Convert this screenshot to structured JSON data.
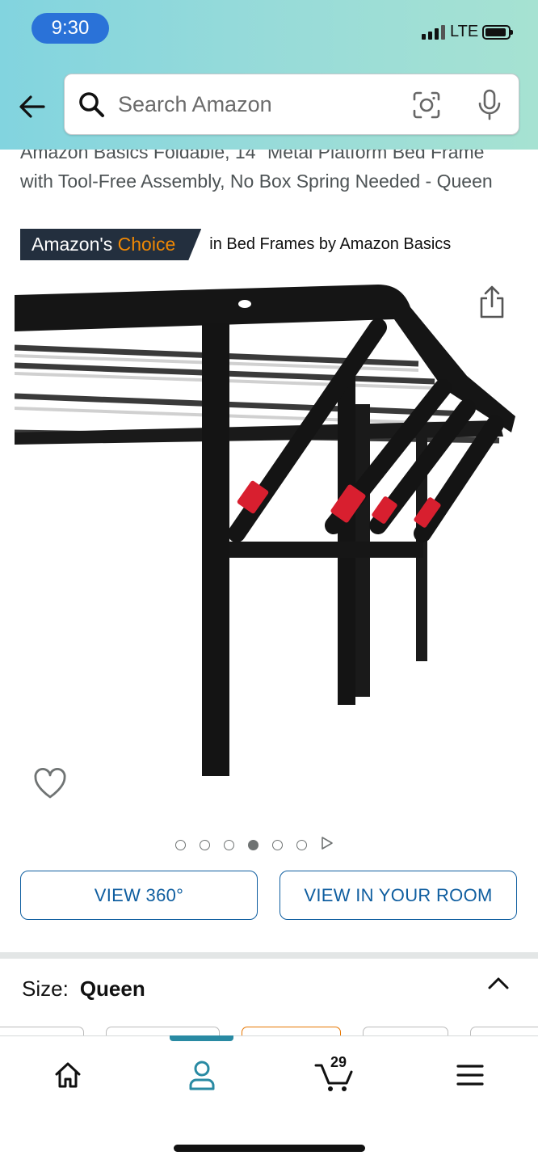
{
  "status_bar": {
    "time": "9:30",
    "network": "LTE"
  },
  "search": {
    "placeholder": "Search Amazon"
  },
  "product": {
    "title": "Amazon Basics Foldable, 14\" Metal Platform Bed Frame with Tool-Free Assembly, No Box Spring Needed - Queen",
    "badge_prefix": "Amazon's ",
    "badge_highlight": "Choice",
    "badge_context": "in Bed Frames by Amazon Basics",
    "image_dots_count": 6,
    "image_dots_active": 4
  },
  "buttons": {
    "view_360": "VIEW 360°",
    "view_in_room": "VIEW IN YOUR ROOM"
  },
  "size": {
    "label": "Size:",
    "value": "Queen"
  },
  "tabbar": {
    "cart_count": "29",
    "active_tab": "account"
  },
  "colors": {
    "accent": "#298aa3",
    "link": "#0f5ea0",
    "badge_bg": "#232f3e",
    "badge_orange": "#f08804"
  },
  "icons": [
    "back-arrow-icon",
    "search-icon",
    "camera-icon",
    "microphone-icon",
    "share-icon",
    "heart-icon",
    "chevron-up-icon",
    "home-icon",
    "account-icon",
    "cart-icon",
    "menu-icon"
  ]
}
